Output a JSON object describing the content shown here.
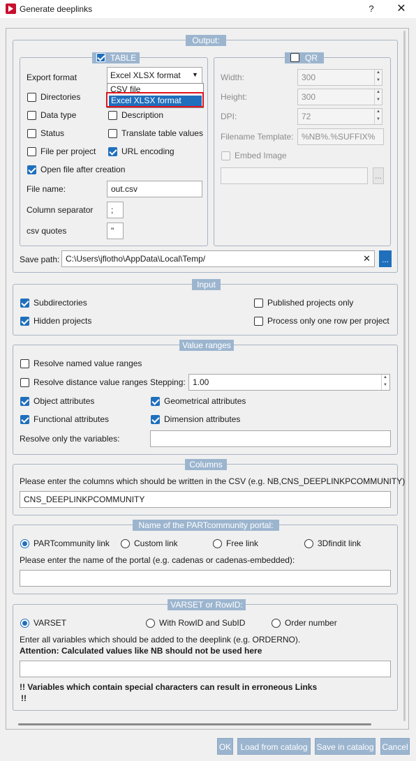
{
  "window": {
    "title": "Generate deeplinks",
    "help": "?",
    "close": "✕"
  },
  "output": {
    "title": "Output:",
    "table": {
      "title": "TABLE",
      "export_format_label": "Export format",
      "export_format_value": "Excel XLSX format",
      "dropdown_options": [
        "CSV file",
        "Excel XLSX format"
      ],
      "directories": "Directories",
      "data_type": "Data type",
      "description": "Description",
      "status": "Status",
      "translate": "Translate table values",
      "file_per_project": "File per project",
      "url_encoding": "URL encoding",
      "open_file": "Open file after creation",
      "file_name_label": "File name:",
      "file_name_value": "out.csv",
      "column_separator_label": "Column separator",
      "column_separator_value": ";",
      "csv_quotes_label": "csv quotes",
      "csv_quotes_value": "\""
    },
    "qr": {
      "title": "QR",
      "width_label": "Width:",
      "width_value": "300",
      "height_label": "Height:",
      "height_value": "300",
      "dpi_label": "DPI:",
      "dpi_value": "72",
      "filename_template_label": "Filename Template:",
      "filename_template_value": "%NB%.%SUFFIX%",
      "embed_image": "Embed Image",
      "browse": "..."
    },
    "save_path_label": "Save path:",
    "save_path_value": "C:\\Users\\jflotho\\AppData\\Local\\Temp/",
    "save_path_clear": "✕",
    "save_path_browse": "..."
  },
  "input": {
    "title": "Input",
    "subdirectories": "Subdirectories",
    "hidden_projects": "Hidden projects",
    "published_only": "Published projects only",
    "one_row": "Process only one row per project"
  },
  "value_ranges": {
    "title": "Value ranges",
    "resolve_named": "Resolve named value ranges",
    "resolve_distance": "Resolve distance value ranges",
    "stepping_label": "Stepping:",
    "stepping_value": "1.00",
    "object_attributes": "Object attributes",
    "geometrical_attributes": "Geometrical attributes",
    "functional_attributes": "Functional attributes",
    "dimension_attributes": "Dimension attributes",
    "resolve_only_label": "Resolve only the variables:"
  },
  "columns": {
    "title": "Columns",
    "hint": "Please enter the columns which should be written in the CSV (e.g. NB,CNS_DEEPLINKPCOMMUNITY)",
    "value": "CNS_DEEPLINKPCOMMUNITY"
  },
  "portal": {
    "title": "Name of the PARTcommunity portal:",
    "options": [
      "PARTcommunity link",
      "Custom link",
      "Free link",
      "3Dfindit link"
    ],
    "hint": "Please enter the name of the portal (e.g. cadenas or cadenas-embedded):"
  },
  "varset": {
    "title": "VARSET or RowID:",
    "options": [
      "VARSET",
      "With RowID and SubID",
      "Order number"
    ],
    "hint": "Enter all variables which should be added to the deeplink (e.g. ORDERNO).",
    "attention": "Attention: Calculated values like NB should not be used here",
    "warning_line1": "!! Variables which contain special characters can result in erroneous Links",
    "warning_line2": "!!"
  },
  "footer": {
    "ok": "OK",
    "load": "Load from catalog",
    "save": "Save in catalog",
    "cancel": "Cancel"
  },
  "colors": {
    "accent": "#1f6fbd",
    "group_title": "#9cb5cf",
    "highlight_border": "#e0141e"
  }
}
